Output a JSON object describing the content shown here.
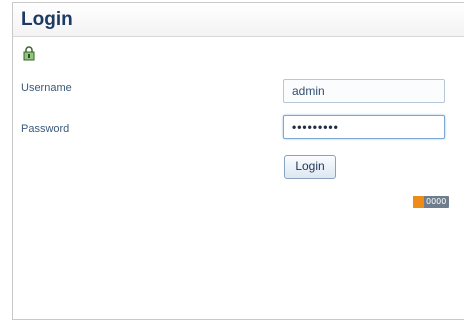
{
  "page": {
    "title": "Login"
  },
  "form": {
    "username_label": "Username",
    "username_value": "admin",
    "password_label": "Password",
    "password_value": "•••••••••",
    "submit_label": "Login"
  },
  "icons": {
    "header_icon": "lock-icon"
  },
  "badge": {
    "text": "0000"
  },
  "colors": {
    "title": "#1d3a63",
    "label": "#3a5a7a",
    "accent": "#ef8b18"
  }
}
